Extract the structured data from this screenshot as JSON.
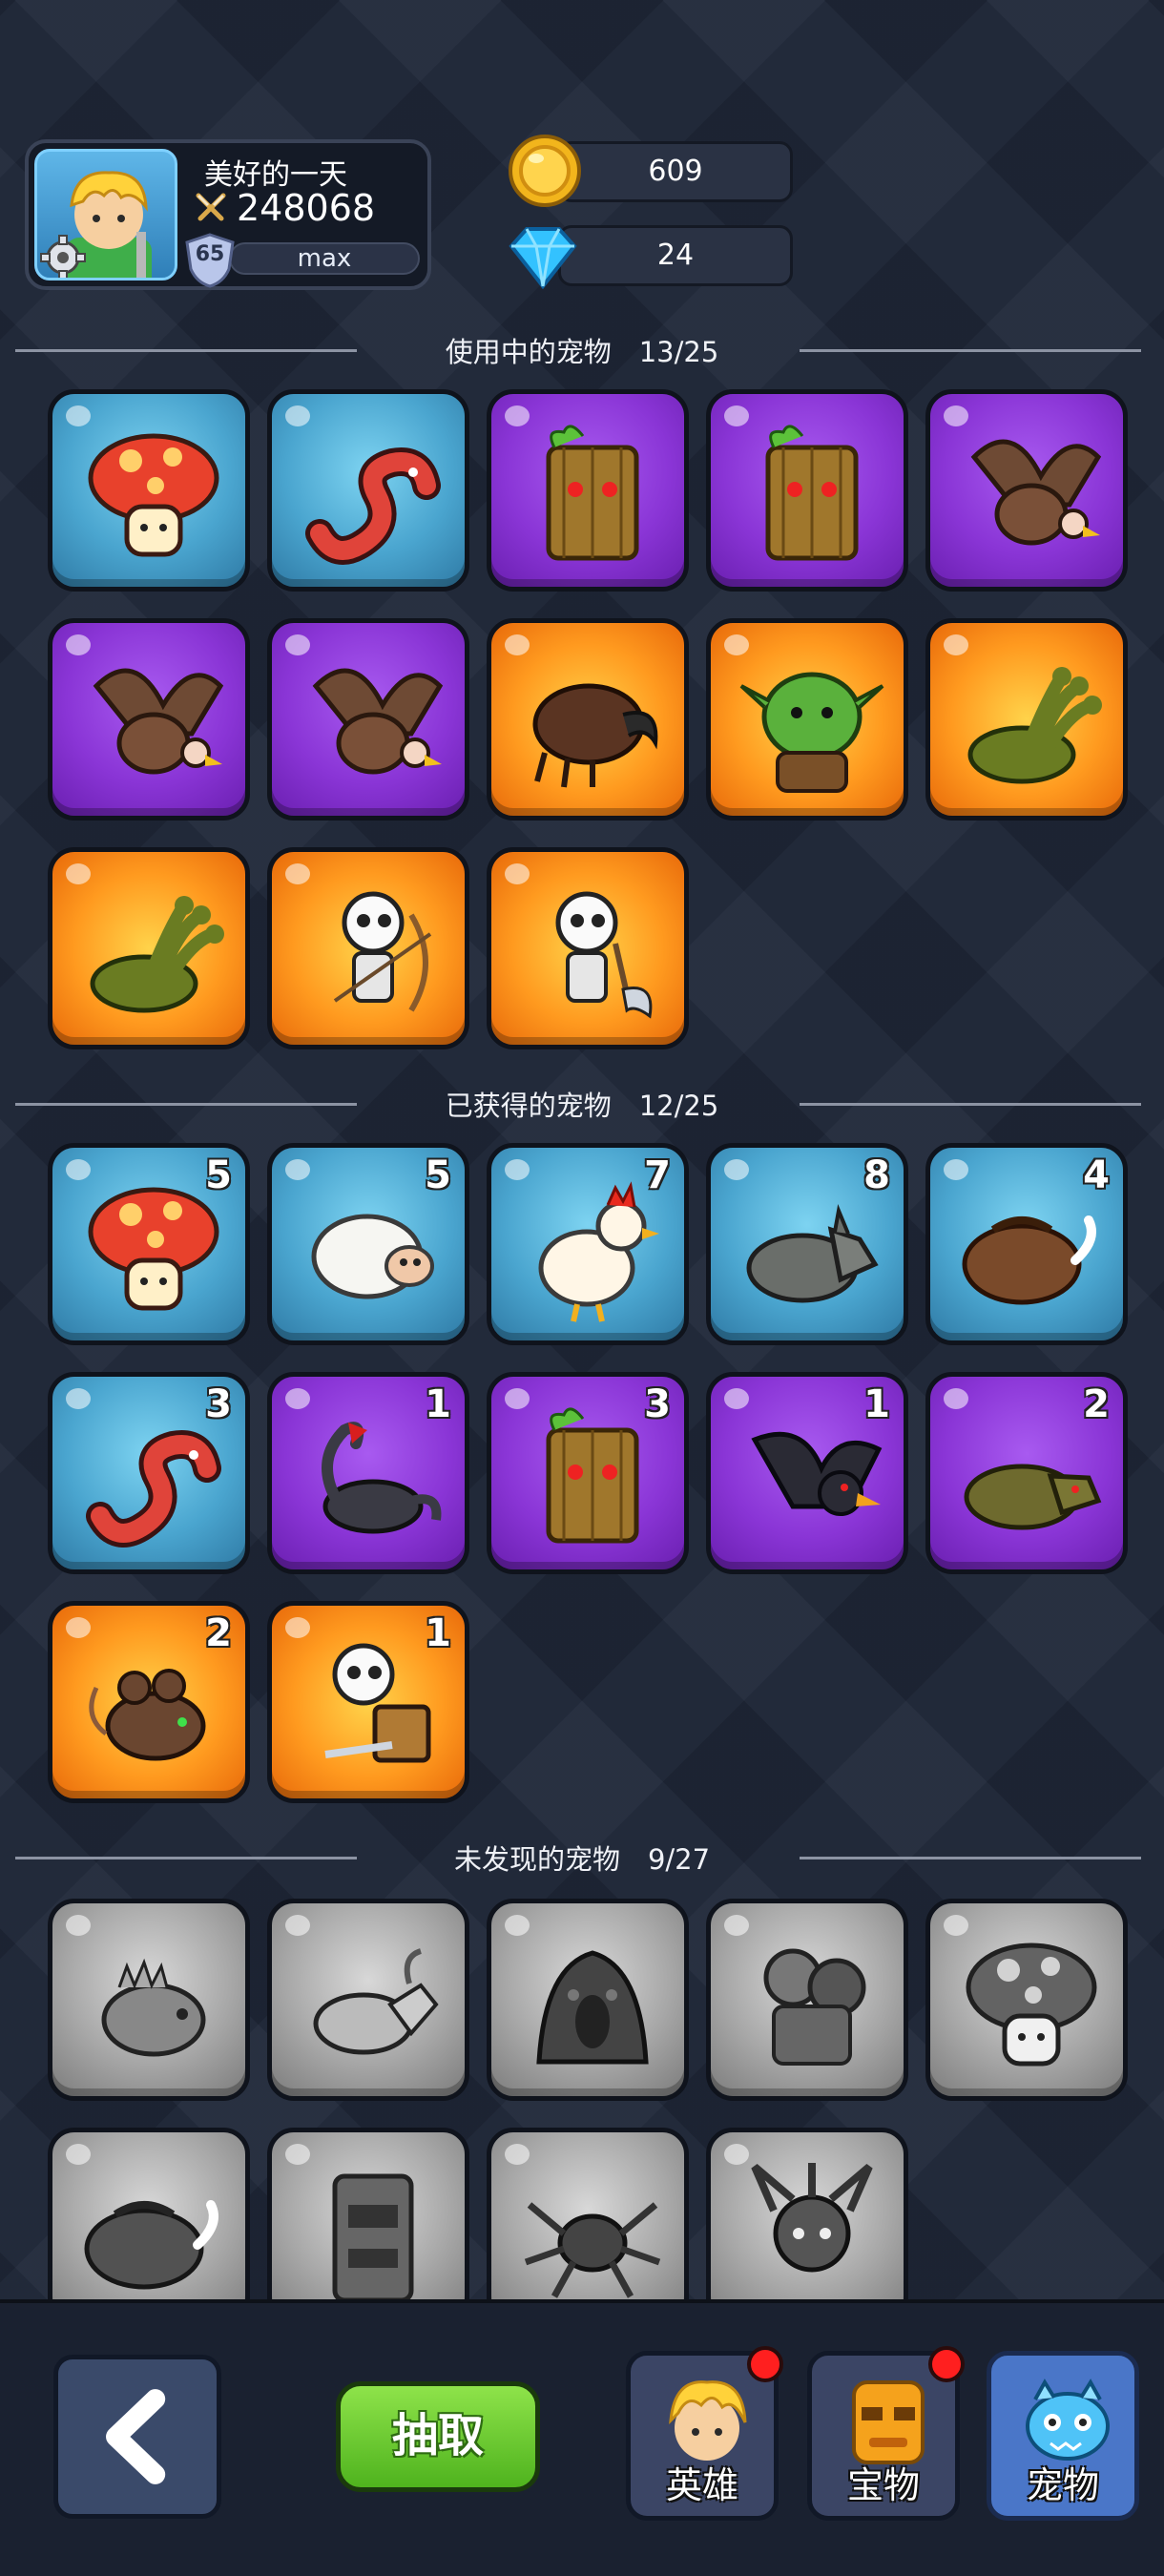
{
  "player": {
    "name": "美好的一天",
    "power": "248068",
    "level": "65",
    "exp_text": "max"
  },
  "resources": {
    "gold": "609",
    "gems": "24"
  },
  "sections": {
    "in_use": {
      "title": "使用中的宠物　13/25"
    },
    "owned": {
      "title": "已获得的宠物　12/25"
    },
    "undiscovered": {
      "title": "未发现的宠物　9/27"
    }
  },
  "in_use_pets": [
    {
      "icon": "mushroom-icon",
      "rarity": "blue"
    },
    {
      "icon": "worm-icon",
      "rarity": "blue"
    },
    {
      "icon": "treant-icon",
      "rarity": "purple"
    },
    {
      "icon": "treant-icon",
      "rarity": "purple"
    },
    {
      "icon": "vulture-icon",
      "rarity": "purple"
    },
    {
      "icon": "vulture-icon",
      "rarity": "purple"
    },
    {
      "icon": "vulture-icon",
      "rarity": "purple"
    },
    {
      "icon": "beetle-icon",
      "rarity": "orange"
    },
    {
      "icon": "goblin-icon",
      "rarity": "orange"
    },
    {
      "icon": "hydra-icon",
      "rarity": "orange"
    },
    {
      "icon": "hydra-icon",
      "rarity": "orange"
    },
    {
      "icon": "skeleton-archer-icon",
      "rarity": "orange"
    },
    {
      "icon": "skeleton-axe-icon",
      "rarity": "orange"
    }
  ],
  "owned_pets": [
    {
      "icon": "mushroom-icon",
      "rarity": "blue",
      "count": "5"
    },
    {
      "icon": "sheep-icon",
      "rarity": "blue",
      "count": "5"
    },
    {
      "icon": "rooster-icon",
      "rarity": "blue",
      "count": "7"
    },
    {
      "icon": "wolf-icon",
      "rarity": "blue",
      "count": "8"
    },
    {
      "icon": "boar-icon",
      "rarity": "blue",
      "count": "4"
    },
    {
      "icon": "worm-icon",
      "rarity": "blue",
      "count": "3"
    },
    {
      "icon": "scorpion-icon",
      "rarity": "purple",
      "count": "1"
    },
    {
      "icon": "treant-icon",
      "rarity": "purple",
      "count": "3"
    },
    {
      "icon": "crow-icon",
      "rarity": "purple",
      "count": "1"
    },
    {
      "icon": "hyena-icon",
      "rarity": "purple",
      "count": "2"
    },
    {
      "icon": "rat-icon",
      "rarity": "orange",
      "count": "2"
    },
    {
      "icon": "skeleton-shield-icon",
      "rarity": "orange",
      "count": "1"
    }
  ],
  "undiscovered_pets": [
    {
      "icon": "lizard-icon",
      "rarity": "gray"
    },
    {
      "icon": "goat-icon",
      "rarity": "gray"
    },
    {
      "icon": "slime-icon",
      "rarity": "gray"
    },
    {
      "icon": "zombie-icon",
      "rarity": "gray"
    },
    {
      "icon": "mushroom-icon",
      "rarity": "gray"
    },
    {
      "icon": "boar-icon",
      "rarity": "gray"
    },
    {
      "icon": "totem-icon",
      "rarity": "gray"
    },
    {
      "icon": "spider-icon",
      "rarity": "gray"
    },
    {
      "icon": "demon-icon",
      "rarity": "gray"
    }
  ],
  "bottom": {
    "draw_label": "抽取",
    "nav": [
      {
        "label": "英雄",
        "badge": true
      },
      {
        "label": "宝物",
        "badge": true
      },
      {
        "label": "宠物",
        "badge": false
      }
    ]
  },
  "colors": {
    "blue_tile": "#4aa5cf",
    "purple_tile": "#8a35d6",
    "orange_tile": "#ff9a1f",
    "gray_tile": "#a7a7a7",
    "draw_button": "#5bc225",
    "badge": "#ff1f1f"
  }
}
